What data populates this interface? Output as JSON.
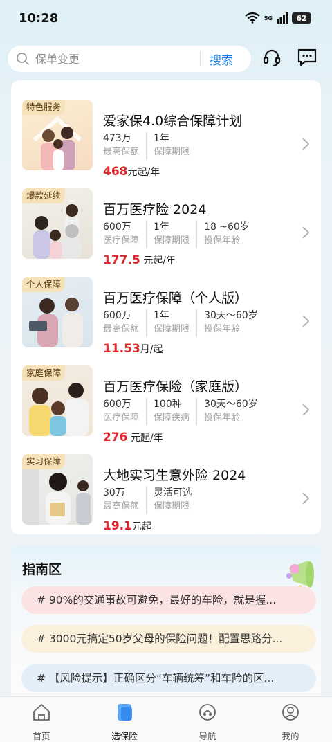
{
  "status_bar": {
    "time": "10:28",
    "network": "5G",
    "battery": "62"
  },
  "search": {
    "placeholder": "保单变更",
    "button_label": "搜索"
  },
  "products": [
    {
      "tag": "特色服务",
      "title": "爱家保4.0综合保障计划",
      "specs": [
        {
          "value": "473万",
          "label": "最高保额"
        },
        {
          "value": "1年",
          "label": "保障期限"
        }
      ],
      "price": "468",
      "price_unit": "元起/年"
    },
    {
      "tag": "爆款延续",
      "title": "百万医疗险 2024",
      "specs": [
        {
          "value": "600万",
          "label": "医疗保障"
        },
        {
          "value": "1年",
          "label": "保障期限"
        },
        {
          "value": "18 ~60岁",
          "label": "投保年龄"
        }
      ],
      "price": "177.5",
      "price_unit": " 元起/年"
    },
    {
      "tag": "个人保障",
      "title": "百万医疗保障（个人版）",
      "specs": [
        {
          "value": "600万",
          "label": "最高保额"
        },
        {
          "value": "1年",
          "label": "保障期限"
        },
        {
          "value": "30天～60岁",
          "label": "投保年龄"
        }
      ],
      "price": "11.53",
      "price_unit": "月/起"
    },
    {
      "tag": "家庭保障",
      "title": "百万医疗保险（家庭版）",
      "specs": [
        {
          "value": "600万",
          "label": "医疗保障"
        },
        {
          "value": "100种",
          "label": "保障疾病"
        },
        {
          "value": "30天～60岁",
          "label": "投保年龄"
        }
      ],
      "price": "276",
      "price_unit": " 元起/年"
    },
    {
      "tag": "实习保障",
      "title": "大地实习生意外险 2024",
      "specs": [
        {
          "value": "30万",
          "label": "最高保额"
        },
        {
          "value": "灵活可选",
          "label": "保障期限"
        }
      ],
      "price": "19.1",
      "price_unit": "元起"
    }
  ],
  "guide": {
    "title": "指南区",
    "items": [
      "# 90%的交通事故可避免，最好的车险，就是握...",
      "# 3000元搞定50岁父母的保险问题！配置思路分...",
      "# 【风险提示】正确区分“车辆统筹”和车险的区..."
    ]
  },
  "tabs": [
    {
      "label": "首页",
      "icon": "home-icon"
    },
    {
      "label": "选保险",
      "icon": "select-insurance-icon"
    },
    {
      "label": "导航",
      "icon": "navigation-icon"
    },
    {
      "label": "我的",
      "icon": "profile-icon"
    }
  ],
  "colors": {
    "accent": "#1f7fe0",
    "price": "#e0262a",
    "tag_bg": "#f5e2b8"
  }
}
